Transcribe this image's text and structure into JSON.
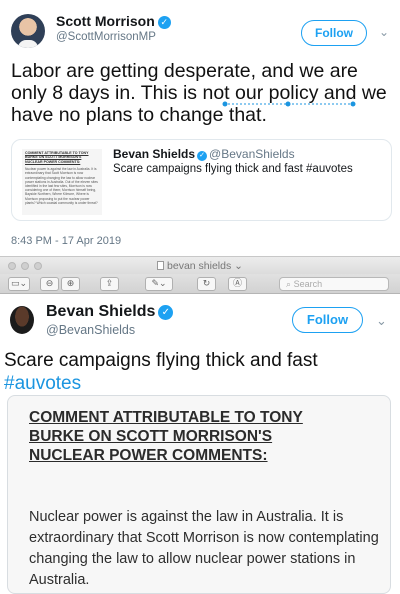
{
  "tweet1": {
    "name": "Scott Morrison",
    "handle": "@ScottMorrisonMP",
    "follow_label": "Follow",
    "text": "Labor are getting desperate, and we are only 8 days in. This is not our policy and we have no plans to change that.",
    "timestamp": "8:43 PM - 17 Apr 2019",
    "quote": {
      "name": "Bevan Shields",
      "handle": "@BevanShields",
      "text": "Scare campaigns flying thick and fast #auvotes",
      "doc_heading": "COMMENT ATTRIBUTABLE TO TONY BURKE ON SCOTT MORRISON'S NUCLEAR POWER COMMENTS:",
      "doc_body": "Nuclear power is against the law in Australia. It is extraordinary that Scott Morrison is now contemplating changing the law to allow nuclear power stations in Australia. Out of the eleven sites identified in the last few sites, Morrison is now considering one of them; Morrison himself being, Bayside Northern, Where Kilmore, Where is Morrison proposing to put the nuclear power plants? Which coastal community is under threat?"
    }
  },
  "window": {
    "title": "bevan shields",
    "search_placeholder": "Search"
  },
  "tweet2": {
    "name": "Bevan Shields",
    "handle": "@BevanShields",
    "follow_label": "Follow",
    "text": "Scare campaigns flying thick and fast",
    "hashtag": "#auvotes",
    "doc_heading_lines": [
      "COMMENT ATTRIBUTABLE TO TONY",
      "BURKE ON SCOTT MORRISON'S",
      "NUCLEAR POWER COMMENTS:"
    ],
    "doc_body": "Nuclear power is against the law in Australia. It is extraordinary that Scott Morrison is now contemplating changing the law to allow nuclear power stations in Australia."
  },
  "colors": {
    "accent": "#1da1f2",
    "link": "#1b95e0",
    "muted": "#657786"
  },
  "icons": [
    "verified-badge-icon",
    "chevron-down-icon",
    "sidebar-toggle-icon",
    "zoom-out-icon",
    "zoom-in-icon",
    "share-icon",
    "pen-icon",
    "rotate-icon",
    "markup-icon",
    "search-icon"
  ]
}
